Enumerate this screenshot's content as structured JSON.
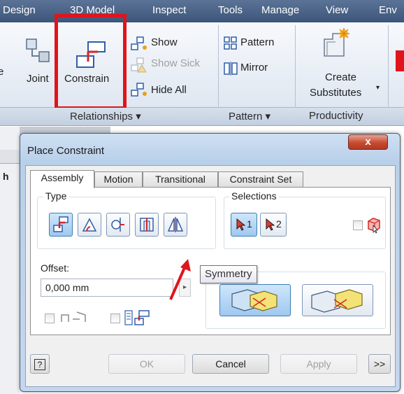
{
  "ribbon": {
    "tabs": [
      "Design",
      "3D Model",
      "Inspect",
      "Tools",
      "Manage",
      "View",
      "Env"
    ],
    "buttons": {
      "joint": "Joint",
      "constrain": "Constrain",
      "show": "Show",
      "show_sick": "Show Sick",
      "hide_all": "Hide All",
      "pattern": "Pattern",
      "mirror": "Mirror",
      "create_substitutes_line1": "Create",
      "create_substitutes_line2": "Substitutes"
    },
    "panels": {
      "relationships": "Relationships ▾",
      "pattern": "Pattern ▾",
      "productivity": "Productivity"
    },
    "highlight_color": "#e0141b"
  },
  "dialog": {
    "title": "Place Constraint",
    "close_label": "x",
    "tabs": [
      "Assembly",
      "Motion",
      "Transitional",
      "Constraint Set"
    ],
    "active_tab": "Assembly",
    "type_label": "Type",
    "type_buttons": [
      "mate-icon",
      "angle-icon",
      "tangent-icon",
      "insert-icon",
      "symmetry-icon"
    ],
    "selections_label": "Selections",
    "selection_1": "1",
    "selection_2": "2",
    "offset_label": "Offset:",
    "offset_value": "0,000 mm",
    "tooltip": "Symmetry",
    "buttons": {
      "ok": "OK",
      "cancel": "Cancel",
      "apply": "Apply",
      "more": ">>"
    },
    "help_label": "?"
  }
}
